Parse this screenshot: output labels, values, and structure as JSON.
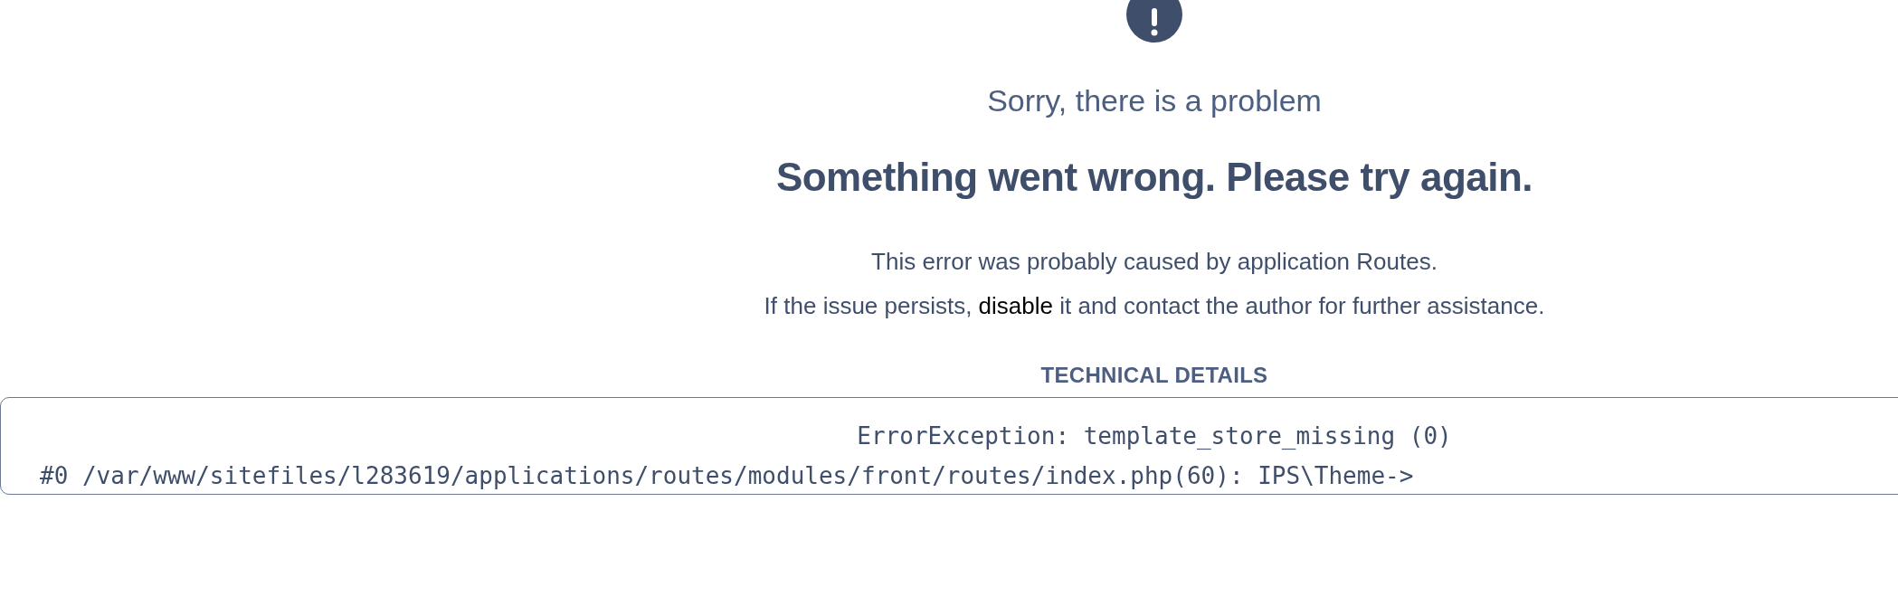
{
  "error": {
    "subtitle": "Sorry, there is a problem",
    "title": "Something went wrong. Please try again.",
    "message_line_1": "This error was probably caused by application Routes.",
    "message_line_2": {
      "before": "If the issue persists, ",
      "link": "disable",
      "after": " it and contact the author for further assistance."
    }
  },
  "technical_details": {
    "heading": "TECHNICAL DETAILS",
    "lines": [
      "ErrorException: template_store_missing (0)",
      "#0 /var/www/sitefiles/l283619/applications/routes/modules/front/routes/index.php(60): IPS\\Theme->"
    ]
  }
}
